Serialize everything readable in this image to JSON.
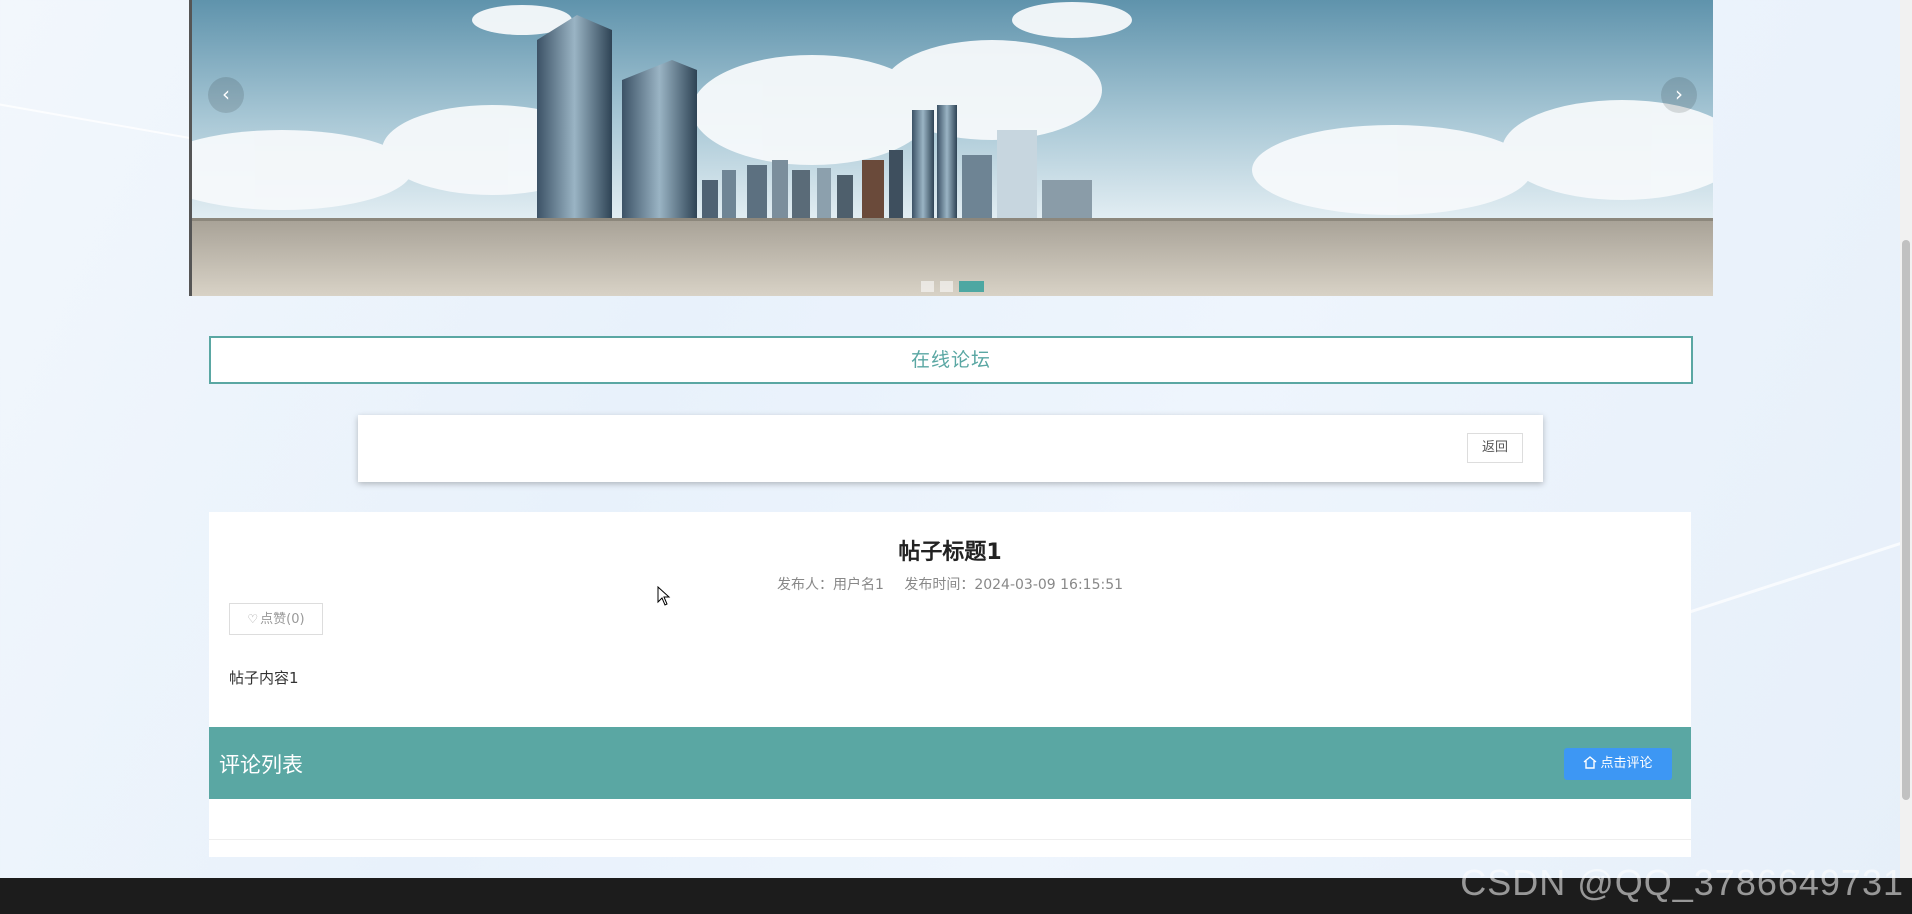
{
  "banner": {
    "prev_arrow": "‹",
    "next_arrow": "›",
    "slide_count": 3,
    "active_slide": 3
  },
  "forum": {
    "title": "在线论坛"
  },
  "toolbar": {
    "back_label": "返回"
  },
  "post": {
    "title": "帖子标题1",
    "author_label": "发布人：用户名1",
    "time_label": "发布时间：2024-03-09 16:15:51",
    "like_label": "点赞(0)",
    "content": "帖子内容1"
  },
  "comments": {
    "header": "评论列表",
    "add_label": "点击评论"
  },
  "watermark": "CSDN @QQ_3786649731",
  "colors": {
    "accent": "#5aa7a3",
    "button_blue": "#3d97f4"
  },
  "icons": [
    "chevron-left-icon",
    "chevron-right-icon",
    "heart-icon",
    "home-icon"
  ]
}
